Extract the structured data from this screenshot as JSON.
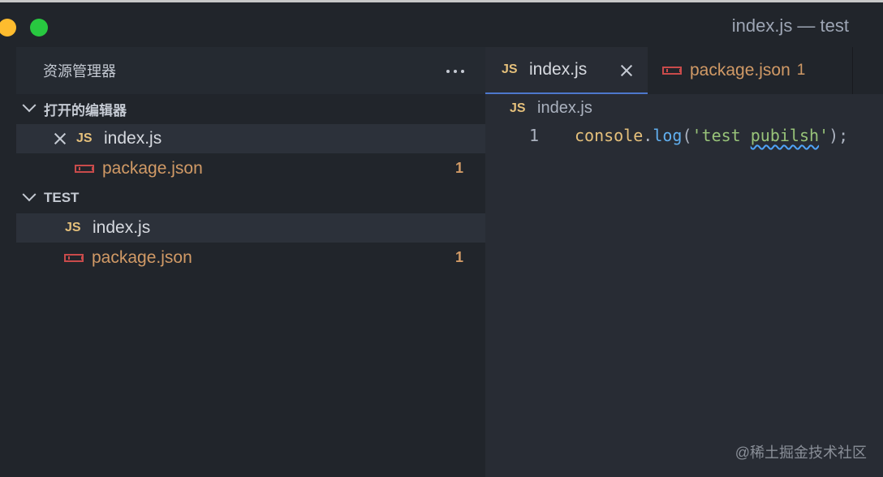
{
  "window": {
    "title": "index.js — test"
  },
  "sidebar": {
    "title": "资源管理器",
    "more_icon": "ellipsis-icon",
    "open_editors": {
      "label": "打开的编辑器",
      "items": [
        {
          "icon": "js-icon",
          "icon_text": "JS",
          "name": "index.js",
          "badge": "",
          "selected": true
        },
        {
          "icon": "npm-icon",
          "name": "package.json",
          "badge": "1",
          "selected": false
        }
      ]
    },
    "project": {
      "label": "TEST",
      "items": [
        {
          "icon": "js-icon",
          "icon_text": "JS",
          "name": "index.js",
          "badge": "",
          "selected": true
        },
        {
          "icon": "npm-icon",
          "name": "package.json",
          "badge": "1",
          "selected": false
        }
      ]
    }
  },
  "editor": {
    "tabs": [
      {
        "icon": "js-icon",
        "icon_text": "JS",
        "label": "index.js",
        "active": true
      },
      {
        "icon": "npm-icon",
        "label": "package.json",
        "badge": "1",
        "active": false
      }
    ],
    "breadcrumb": {
      "icon_text": "JS",
      "file": "index.js"
    },
    "lines": [
      {
        "number": "1",
        "tokens": {
          "obj": "console",
          "dot": ".",
          "fn": "log",
          "open": "(",
          "str_start": "'test ",
          "str_misspelled": "pubilsh",
          "str_end": "'",
          "close": ");"
        }
      }
    ]
  },
  "watermark": "@稀土掘金技术社区",
  "colors": {
    "background": "#21252b",
    "editor_bg": "#282c34",
    "js_yellow": "#e5c07b",
    "npm_red": "#c94b4b",
    "modified_orange": "#d19a66",
    "active_tab_border": "#4d78cc"
  }
}
